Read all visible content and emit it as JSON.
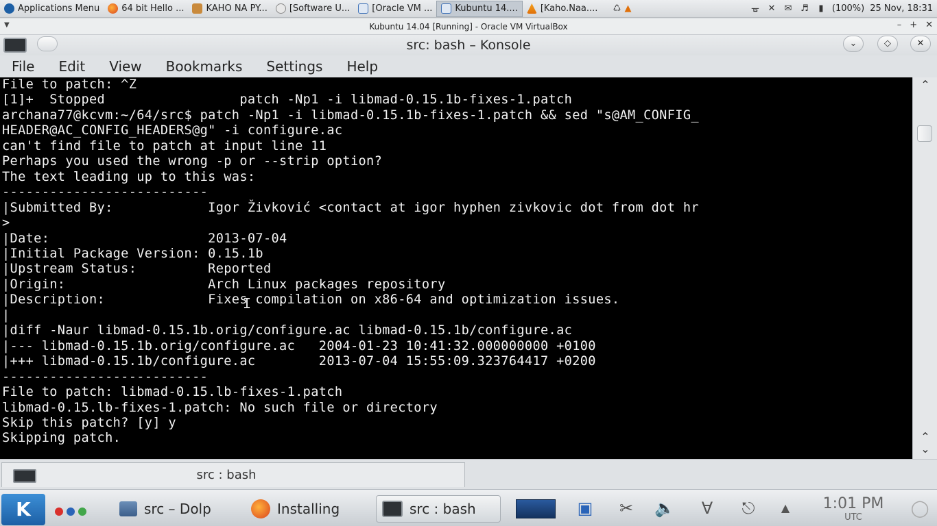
{
  "host_panel": {
    "tasks": [
      {
        "label": "Applications Menu",
        "icon": "kubuntu-logo-icon"
      },
      {
        "label": "64 bit Hello ...",
        "icon": "firefox-icon"
      },
      {
        "label": "KAHO NA PY...",
        "icon": "folder-icon"
      },
      {
        "label": "[Software U...",
        "icon": "software-updater-icon"
      },
      {
        "label": "[Oracle VM ...",
        "icon": "virtualbox-icon"
      },
      {
        "label": "Kubuntu 14....",
        "icon": "virtualbox-icon"
      },
      {
        "label": "[Kaho.Naa....",
        "icon": "vlc-icon"
      }
    ],
    "battery": "(100%)",
    "datetime": "25 Nov, 18:31"
  },
  "vbox": {
    "title": "Kubuntu 14.04 [Running] - Oracle VM VirtualBox",
    "minimize": "–",
    "maximize": "+",
    "close": "✕"
  },
  "konsole": {
    "title": "src: bash – Konsole",
    "menu": [
      "File",
      "Edit",
      "View",
      "Bookmarks",
      "Settings",
      "Help"
    ],
    "terminal_lines": [
      "File to patch: ^Z",
      "[1]+  Stopped                 patch -Np1 -i libmad-0.15.1b-fixes-1.patch",
      "archana77@kcvm:~/64/src$ patch -Np1 -i libmad-0.15.1b-fixes-1.patch && sed \"s@AM_CONFIG_",
      "HEADER@AC_CONFIG_HEADERS@g\" -i configure.ac",
      "can't find file to patch at input line 11",
      "Perhaps you used the wrong -p or --strip option?",
      "The text leading up to this was:",
      "--------------------------",
      "|Submitted By:            Igor Živković <contact at igor hyphen zivkovic dot from dot hr",
      ">",
      "|Date:                    2013-07-04",
      "|Initial Package Version: 0.15.1b",
      "|Upstream Status:         Reported",
      "|Origin:                  Arch Linux packages repository",
      "|Description:             Fixes compilation on x86-64 and optimization issues.",
      "|",
      "|diff -Naur libmad-0.15.1b.orig/configure.ac libmad-0.15.1b/configure.ac",
      "|--- libmad-0.15.1b.orig/configure.ac   2004-01-23 10:41:32.000000000 +0100",
      "|+++ libmad-0.15.1b/configure.ac        2013-07-04 15:55:09.323764417 +0200",
      "--------------------------",
      "File to patch: libmad-0.15.lb-fixes-1.patch",
      "libmad-0.15.lb-fixes-1.patch: No such file or directory",
      "Skip this patch? [y] y",
      "Skipping patch."
    ],
    "tab_label": "src : bash"
  },
  "kde_panel": {
    "tasks": [
      {
        "label": "src – Dolp",
        "icon": "dolphin-icon"
      },
      {
        "label": "Installing",
        "icon": "firefox-icon"
      },
      {
        "label": "src : bash",
        "icon": "konsole-icon"
      }
    ],
    "time": "1:01 PM",
    "timezone": "UTC"
  }
}
